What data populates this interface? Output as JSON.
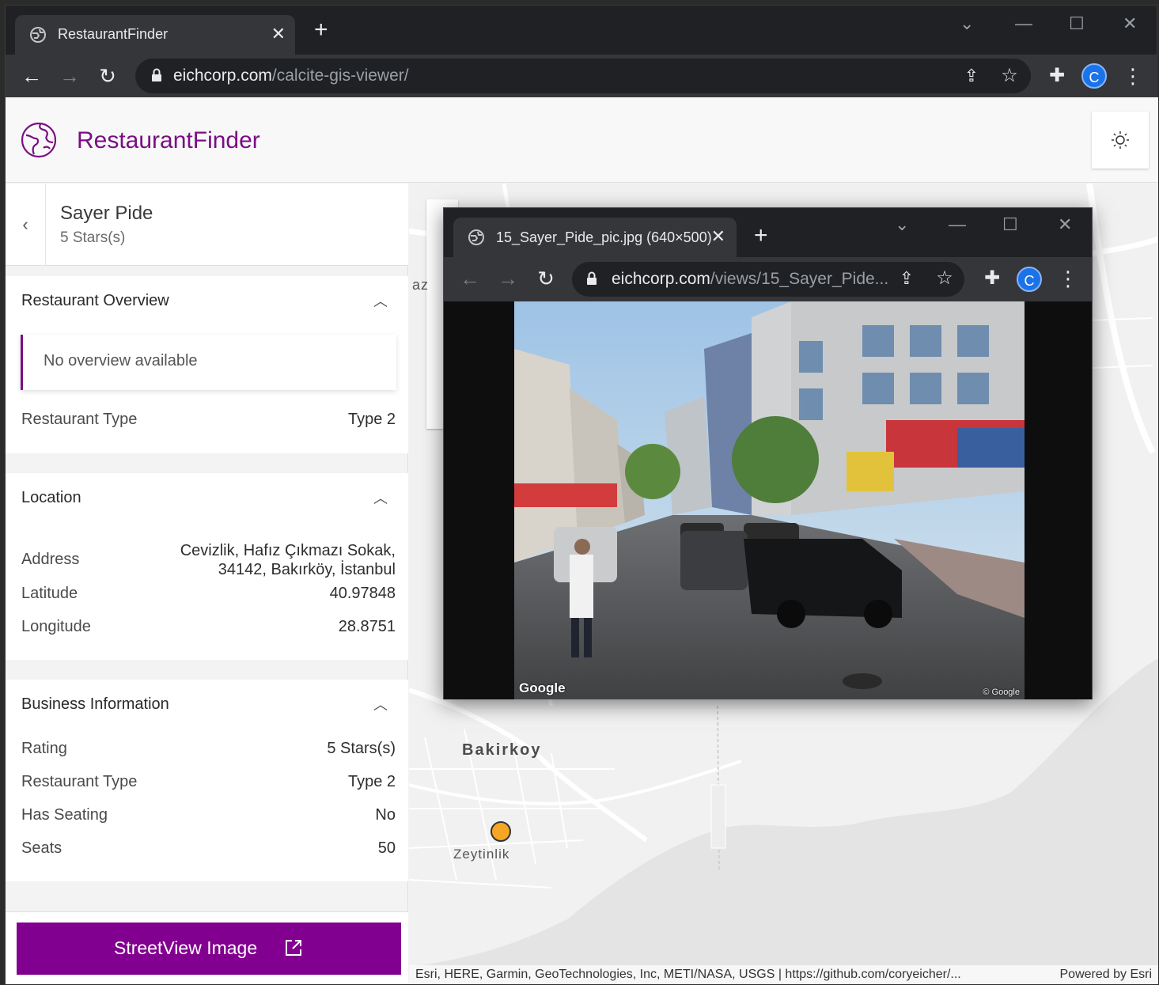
{
  "browser": {
    "tab_title": "RestaurantFinder",
    "url_host": "eichcorp.com",
    "url_path": "/calcite-gis-viewer/",
    "profile_initial": "C"
  },
  "app": {
    "title": "RestaurantFinder",
    "accent_color": "#7a0e84"
  },
  "panel": {
    "heading": "Sayer Pide",
    "description": "5 Stars(s)",
    "overview": {
      "title": "Restaurant Overview",
      "notice": "No overview available",
      "rows": [
        {
          "label": "Restaurant Type",
          "value": "Type 2"
        }
      ]
    },
    "location": {
      "title": "Location",
      "address_label": "Address",
      "address_line1": "Cevizlik, Hafız Çıkmazı Sokak,",
      "address_line2": "34142, Bakırköy, İstanbul",
      "rows": [
        {
          "label": "Latitude",
          "value": "40.97848"
        },
        {
          "label": "Longitude",
          "value": "28.8751"
        }
      ]
    },
    "business": {
      "title": "Business Information",
      "rows": [
        {
          "label": "Rating",
          "value": "5 Stars(s)"
        },
        {
          "label": "Restaurant Type",
          "value": "Type 2"
        },
        {
          "label": "Has Seating",
          "value": "No"
        },
        {
          "label": "Seats",
          "value": "50"
        }
      ]
    },
    "streetview_button": "StreetView Image"
  },
  "map": {
    "places": {
      "major": "Bakirkoy",
      "minor": "Zeytinlik",
      "partial": "az"
    },
    "attribution_left": "Esri, HERE, Garmin, GeoTechnologies, Inc, METI/NASA, USGS | https://github.com/coryeicher/...",
    "attribution_right": "Powered by Esri",
    "marker_color": "#f5a623"
  },
  "popup": {
    "tab_title": "15_Sayer_Pide_pic.jpg (640×500)",
    "url_host": "eichcorp.com",
    "url_path": "/views/15_Sayer_Pide...",
    "profile_initial": "C",
    "image_watermark_left": "Google",
    "image_watermark_right": "© Google"
  }
}
